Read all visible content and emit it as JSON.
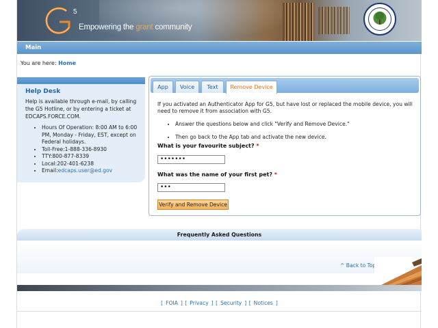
{
  "header": {
    "logo_text": "G5",
    "tagline_before": "Empowering the ",
    "tagline_highlight": "grant",
    "tagline_after": " community",
    "seal_text": "DEPARTMENT OF EDUCATION · UNITED STATES OF AMERICA"
  },
  "main_bar": {
    "title": "Main"
  },
  "breadcrumb": {
    "prefix": "You are here: ",
    "current": "Home"
  },
  "help_desk": {
    "title": "Help Desk",
    "intro": "Help is available through e-mail, by calling the G5 Hotline, or by entering a ticket at EDCAPS.FORCE.COM.",
    "items": [
      "Hours Of Operation: 8:00 AM to 6:00 PM, Monday - Friday, EST, except on Federal holidays.",
      "Toll-Free:1-888-336-8930",
      "TTY:800-877-8339",
      "Local:202-401-6238"
    ],
    "email_label": "Email:",
    "email_value": "edcaps.user@ed.gov"
  },
  "tabs": [
    {
      "label": "App",
      "active": false
    },
    {
      "label": "Voice",
      "active": false
    },
    {
      "label": "Text",
      "active": false
    },
    {
      "label": "Remove Device",
      "active": true
    }
  ],
  "remove_device": {
    "intro": "If you activated an Authenticator App for G5, but have lost or replaced the mobile device, you will need to remove it from association with G5.",
    "steps": [
      "Answer the questions below and click \"Verify and Remove Device.\"",
      "Then go back to the App tab and activate the new device."
    ],
    "question1": "What is your favourite subject?",
    "answer1": "•••••••",
    "question2": "What was the name of your first pet?",
    "answer2": "•••",
    "required_mark": "*",
    "verify_button": "Verify and Remove Device"
  },
  "faq": {
    "title": "Frequently Asked Questions",
    "back_to_top": "^ Back to Top"
  },
  "footer": {
    "links": [
      "FOIA",
      "Privacy",
      "Security",
      "Notices"
    ]
  },
  "colors": {
    "accent_blue": "#5b95cb",
    "link_blue": "#2a6fb0",
    "active_tab": "#e4711b",
    "button_orange": "#f6b05a",
    "required_red": "#d02020"
  }
}
